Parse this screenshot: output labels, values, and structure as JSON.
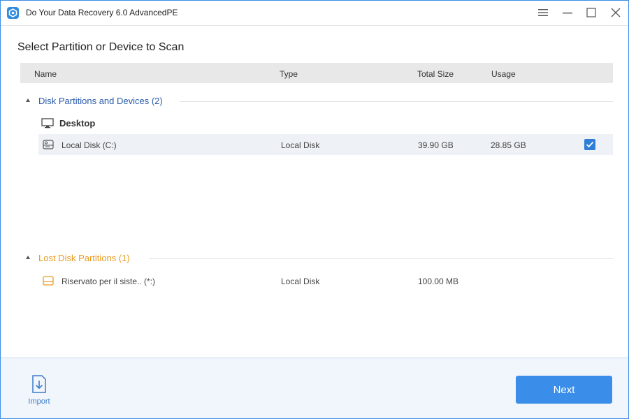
{
  "window": {
    "title": "Do Your Data Recovery 6.0 AdvancedPE"
  },
  "main": {
    "heading": "Select Partition or Device to Scan",
    "columns": {
      "name": "Name",
      "type": "Type",
      "total_size": "Total Size",
      "usage": "Usage"
    },
    "disk_group": {
      "label": "Disk Partitions and Devices (2)",
      "devices": [
        {
          "label": "Desktop",
          "icon": "monitor-icon",
          "rows": [
            {
              "name": "Local Disk (C:)",
              "type": "Local Disk",
              "total_size": "39.90 GB",
              "usage": "28.85 GB",
              "checked": true,
              "icon": "hard-disk-icon"
            }
          ]
        }
      ]
    },
    "lost_group": {
      "label": "Lost Disk Partitions (1)",
      "rows": [
        {
          "name": "Riservato per il siste.. (*:)",
          "type": "Local Disk",
          "total_size": "100.00 MB",
          "usage": "",
          "icon": "lost-partition-icon"
        }
      ]
    }
  },
  "footer": {
    "import_label": "Import",
    "next_label": "Next"
  },
  "colors": {
    "accent": "#3a8de8",
    "disk_group": "#2a5caa",
    "lost_group": "#e89a1f",
    "footer_bg": "#f1f6fc"
  }
}
